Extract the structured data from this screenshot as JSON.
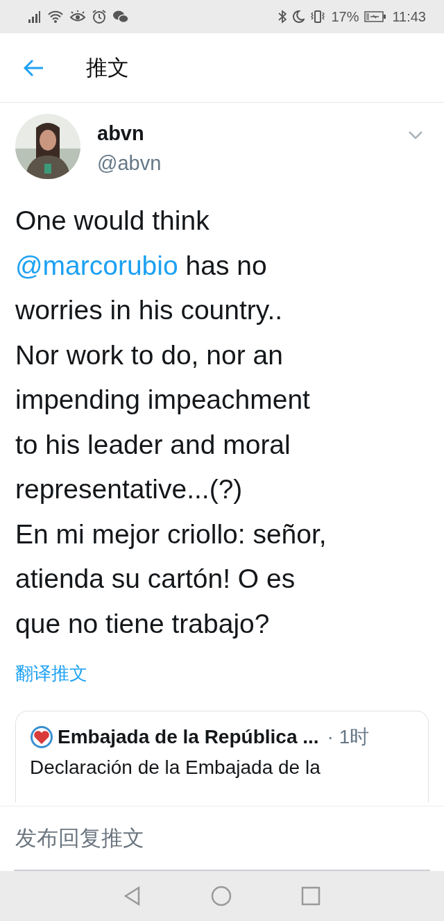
{
  "status_bar": {
    "battery_text": "17%",
    "time": "11:43"
  },
  "header": {
    "title": "推文"
  },
  "tweet": {
    "author_name": "abvn",
    "handle": "@abvn",
    "body": [
      {
        "kind": "text",
        "text": "One would think\n"
      },
      {
        "kind": "mention",
        "text": "@marcorubio"
      },
      {
        "kind": "text",
        "text": " has no\nworries in his country..\nNor work to do, nor an\nimpending impeachment\nto his leader and moral\nrepresentative...(?)\nEn mi mejor criollo: señor,\natienda su cartón! O es\nque no tiene trabajo?"
      }
    ],
    "translate_link": "翻译推文",
    "quoted": {
      "author_name": "Embajada de la República ...",
      "time": "· 1时",
      "text": "Declaración de la Embajada de la"
    }
  },
  "reply_bar": {
    "placeholder": "发布回复推文"
  }
}
